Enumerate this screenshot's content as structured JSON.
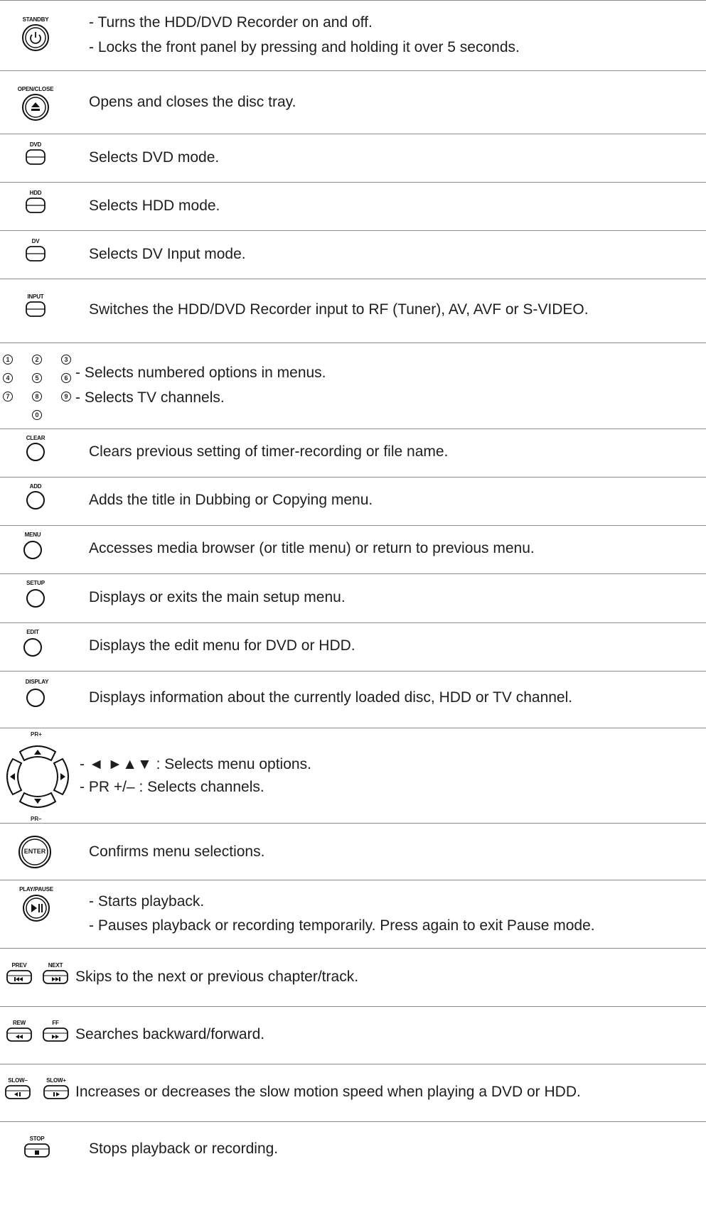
{
  "rows": [
    {
      "label": "STANDBY",
      "lines": [
        "- Turns the HDD/DVD Recorder on and off.",
        "- Locks the front panel by pressing and holding it over 5 seconds."
      ]
    },
    {
      "label": "OPEN/CLOSE",
      "lines": [
        "Opens and closes the disc tray."
      ]
    },
    {
      "label": "DVD",
      "lines": [
        "Selects DVD mode."
      ]
    },
    {
      "label": "HDD",
      "lines": [
        "Selects HDD mode."
      ]
    },
    {
      "label": "DV",
      "lines": [
        "Selects DV Input mode."
      ]
    },
    {
      "label": "INPUT",
      "lines": [
        "Switches the HDD/DVD Recorder input to RF (Tuner), AV, AVF or S-VIDEO."
      ]
    },
    {
      "label": "",
      "digits": [
        "1",
        "2",
        "3",
        "4",
        "5",
        "6",
        "7",
        "8",
        "9",
        "0"
      ],
      "lines": [
        "- Selects numbered options in menus.",
        "- Selects TV channels."
      ]
    },
    {
      "label": "CLEAR",
      "lines": [
        "Clears previous setting of timer-recording or file name."
      ]
    },
    {
      "label": "ADD",
      "lines": [
        "Adds the title in Dubbing or Copying menu."
      ]
    },
    {
      "label": "MENU",
      "lines": [
        "Accesses media browser (or title menu) or return to previous menu."
      ]
    },
    {
      "label": "SETUP",
      "lines": [
        "Displays or exits the main setup menu."
      ]
    },
    {
      "label": "EDIT",
      "lines": [
        "Displays the edit menu for DVD or HDD."
      ]
    },
    {
      "label": "DISPLAY",
      "lines": [
        "Displays information about the currently loaded disc, HDD or TV channel."
      ]
    },
    {
      "label_top": "PR+",
      "label_bottom": "PR–",
      "lines": [
        "- ◄ ►▲▼ : Selects menu options.",
        "- PR +/– : Selects channels."
      ]
    },
    {
      "label": "ENTER",
      "lines": [
        "Confirms menu selections."
      ]
    },
    {
      "label": "PLAY/PAUSE",
      "lines": [
        "- Starts playback.",
        "- Pauses playback or recording temporarily. Press again to exit Pause mode."
      ]
    },
    {
      "labels": [
        "PREV",
        "NEXT"
      ],
      "lines": [
        "Skips to the next or previous chapter/track."
      ]
    },
    {
      "labels": [
        "REW",
        "FF"
      ],
      "lines": [
        "Searches backward/forward."
      ]
    },
    {
      "labels": [
        "SLOW–",
        "SLOW+"
      ],
      "lines": [
        "Increases or decreases the slow motion speed when playing a DVD or HDD."
      ]
    },
    {
      "label": "STOP",
      "lines": [
        "Stops playback or recording."
      ]
    }
  ]
}
